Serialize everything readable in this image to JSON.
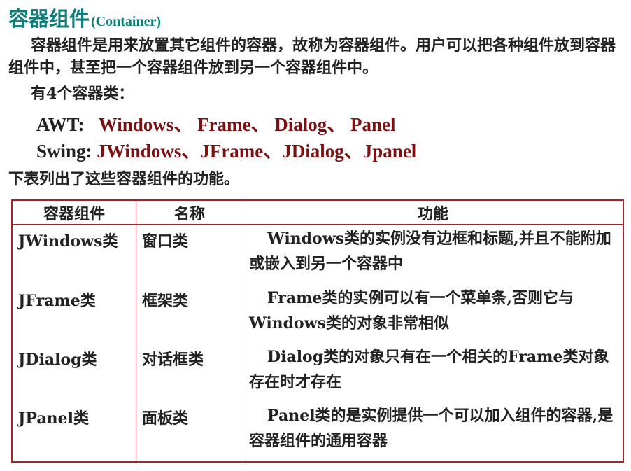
{
  "title": {
    "main": "容器组件",
    "sub": "(Container)"
  },
  "intro": "容器组件是用来放置其它组件的容器，故称为容器组件。用户可以把各种组件放到容器组件中，甚至把一个容器组件放到另一个容器组件中。",
  "count_line": "有4个容器类：",
  "awt": {
    "label": "AWT:",
    "items": "Windows、 Frame、  Dialog、  Panel"
  },
  "swing": {
    "label": "Swing:",
    "items": "JWindows、JFrame、JDialog、Jpanel"
  },
  "table_intro": "下表列出了这些容器组件的功能。",
  "table": {
    "headers": [
      "容器组件",
      "名称",
      "功能"
    ],
    "rows": [
      {
        "component": "JWindows类",
        "name": "窗口类",
        "function": "Windows类的实例没有边框和标题,并且不能附加或嵌入到另一个容器中"
      },
      {
        "component": "JFrame类",
        "name": "框架类",
        "function": "Frame类的实例可以有一个菜单条,否则它与Windows类的对象非常相似"
      },
      {
        "component": "JDialog类",
        "name": "对话框类",
        "function": "Dialog类的对象只有在一个相关的Frame类对象存在时才存在"
      },
      {
        "component": "JPanel类",
        "name": "面板类",
        "function": "Panel类的是实例提供一个可以加入组件的容器,是容器组件的通用容器"
      }
    ]
  },
  "colors": {
    "title": "#0e7d7a",
    "class_names": "#7a1012",
    "table_border": "#a8202a",
    "text": "#222222"
  }
}
